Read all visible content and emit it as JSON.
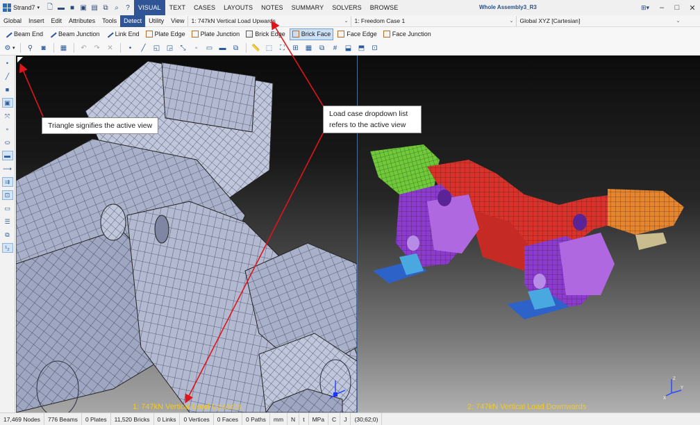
{
  "app": {
    "name": "Strand7",
    "document_title": "Whole Assembly3_R3"
  },
  "quick_access": [
    "new-icon",
    "open-icon",
    "save-icon",
    "save-as-icon",
    "print-icon",
    "copy-icon",
    "find-icon",
    "help-icon"
  ],
  "ribbon_tabs": [
    {
      "label": "VISUAL",
      "active": true
    },
    {
      "label": "TEXT",
      "active": false
    },
    {
      "label": "CASES",
      "active": false
    },
    {
      "label": "LAYOUTS",
      "active": false
    },
    {
      "label": "NOTES",
      "active": false
    },
    {
      "label": "SUMMARY",
      "active": false
    },
    {
      "label": "SOLVERS",
      "active": false
    },
    {
      "label": "BROWSE",
      "active": false
    }
  ],
  "menu": [
    {
      "label": "Global",
      "active": false
    },
    {
      "label": "Insert",
      "active": false
    },
    {
      "label": "Edit",
      "active": false
    },
    {
      "label": "Attributes",
      "active": false
    },
    {
      "label": "Tools",
      "active": false
    },
    {
      "label": "Detect",
      "active": true
    },
    {
      "label": "Utility",
      "active": false
    },
    {
      "label": "View",
      "active": false
    }
  ],
  "load_case_combo": {
    "value": "1: 747kN Vertical Load Upwards"
  },
  "freedom_case_combo": {
    "value": "1: Freedom Case 1"
  },
  "ucs_combo": {
    "value": "Global XYZ [Cartesian]"
  },
  "detect_buttons": [
    {
      "label": "Beam End",
      "icon": "line",
      "active": false
    },
    {
      "label": "Beam Junction",
      "icon": "line",
      "active": false
    },
    {
      "label": "Link End",
      "icon": "line",
      "active": false
    },
    {
      "label": "Plate Edge",
      "icon": "box",
      "active": false
    },
    {
      "label": "Plate Junction",
      "icon": "box",
      "active": false
    },
    {
      "label": "Brick Edge",
      "icon": "cube",
      "active": false
    },
    {
      "label": "Brick Face",
      "icon": "box",
      "active": true
    },
    {
      "label": "Face Edge",
      "icon": "box",
      "active": false
    },
    {
      "label": "Face Junction",
      "icon": "box",
      "active": false
    }
  ],
  "views": {
    "left": {
      "label": "1: 747kN Vertical Load Upwards"
    },
    "right": {
      "label": "2: 747kN Vertical Load Downwards"
    }
  },
  "callouts": {
    "active_view": "Triangle signifies the active view",
    "dropdown_line1": "Load case dropdown list",
    "dropdown_line2": "refers to the active view"
  },
  "axis_labels": {
    "x": "X",
    "y": "Y",
    "z": "Z"
  },
  "status": [
    "17,469 Nodes",
    "776 Beams",
    "0 Plates",
    "11,520 Bricks",
    "0 Links",
    "0 Vertices",
    "0 Faces",
    "0 Paths",
    "mm",
    "N",
    "t",
    "MPa",
    "C",
    "J",
    "(30;62;0)"
  ],
  "colors": {
    "accent": "#2f5597",
    "load_label": "#f4cb1b",
    "annotation_arrow": "#e0141b",
    "mesh_left": "#a7aec8",
    "part_red": "#d8322a",
    "part_purple": "#8b3ccf",
    "part_violet": "#b068e0",
    "part_green": "#6fc93a",
    "part_orange": "#e5862f",
    "part_blue": "#2d63c9",
    "part_lightblue": "#4aa8e0",
    "part_tan": "#c9bd8f"
  }
}
